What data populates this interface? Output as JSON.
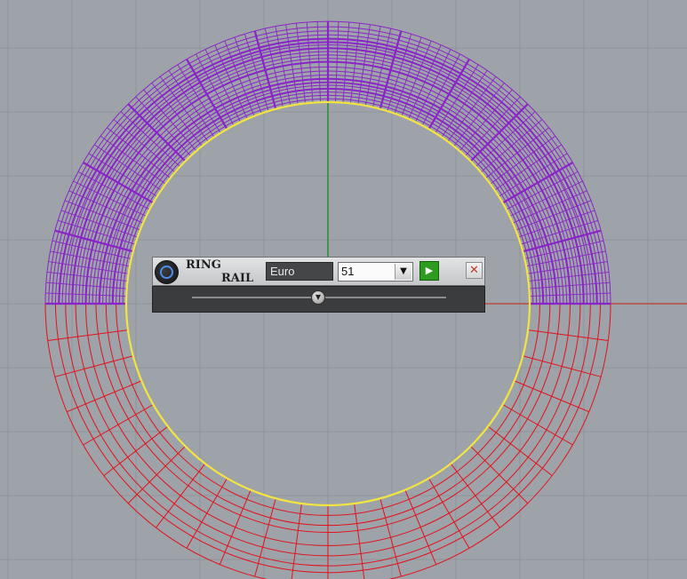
{
  "toolbar": {
    "title_line1": "RING",
    "title_line2": "RAIL",
    "name_value": "Euro",
    "count_value": "51",
    "play_icon": "play-icon",
    "close_icon": "close-icon",
    "logo_icon": "ring-logo-icon"
  },
  "viewport": {
    "upper_ring_color": "#8a24c8",
    "lower_ring_color": "#e3111b",
    "inner_edge_color": "#f3e442",
    "y_axis_color": "#1e8c2c",
    "x_axis_color": "#c0392b",
    "grid_color": "#8e959b",
    "background": "#9da3a9"
  }
}
